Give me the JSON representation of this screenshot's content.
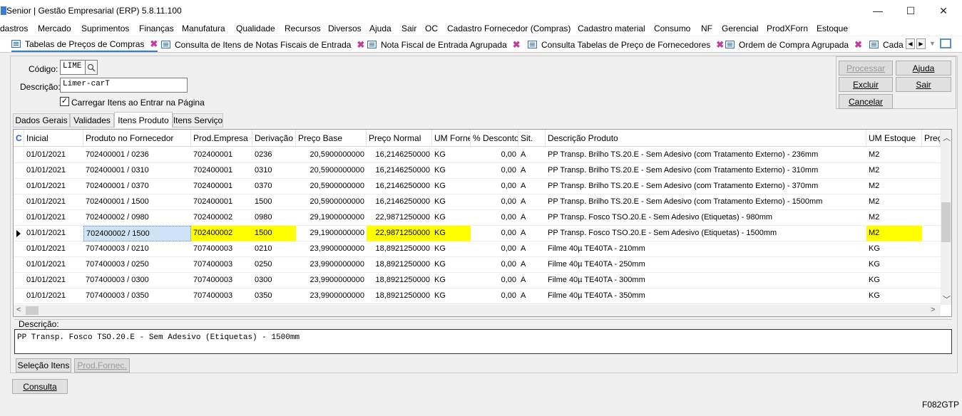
{
  "window": {
    "title": "Senior | Gestão Empresarial (ERP) 5.8.11.100",
    "minimize": "—",
    "maximize": "☐",
    "close": "✕"
  },
  "menu": [
    "dastros",
    "Mercado",
    "Suprimentos",
    "Finanças",
    "Manufatura",
    "Qualidade",
    "Recursos",
    "Diversos",
    "Ajuda",
    "Sair",
    "OC",
    "Cadastro Fornecedor (Compras)",
    "Cadastro material",
    "Consumo",
    "NF",
    "Gerencial",
    "ProdXForn",
    "Estoque"
  ],
  "tabs": [
    {
      "label": "Tabelas de Preços de Compras",
      "active": true
    },
    {
      "label": "Consulta de Itens de Notas Fiscais de Entrada"
    },
    {
      "label": "Nota Fiscal de Entrada Agrupada"
    },
    {
      "label": "Consulta Tabelas de Preço de Fornecedores"
    },
    {
      "label": "Ordem de Compra Agrupada"
    },
    {
      "label": "Cada"
    }
  ],
  "form": {
    "codigo_label": "Código:",
    "codigo_value": "LIME",
    "descricao_label": "Descrição:",
    "descricao_value": "Limer-carT",
    "carregar_label": "Carregar Itens ao Entrar na Página",
    "carregar_checked": "✓"
  },
  "buttons": {
    "processar": "Processar",
    "ajuda": "Ajuda",
    "excluir": "Excluir",
    "sair": "Sair",
    "cancelar": "Cancelar"
  },
  "subtabs": [
    "Dados Gerais",
    "Validades",
    "Itens Produto",
    "Itens Serviço"
  ],
  "grid": {
    "headers": [
      "C",
      "Inicial",
      "Produto no Fornecedor",
      "Prod.Empresa",
      "Derivação",
      "Preço Base",
      "Preço Normal",
      "UM Forne",
      "% Desconto",
      "Sit.",
      "Descrição Produto",
      "UM Estoque",
      "Preç"
    ],
    "rows": [
      [
        "01/01/2021",
        "702400001 / 0236",
        "702400001",
        "0236",
        "20,5900000000",
        "16,2146250000",
        "KG",
        "0,00",
        "A",
        "PP Transp. Brilho TS.20.E - Sem Adesivo (com Tratamento Externo) - 236mm",
        "M2"
      ],
      [
        "01/01/2021",
        "702400001 / 0310",
        "702400001",
        "0310",
        "20,5900000000",
        "16,2146250000",
        "KG",
        "0,00",
        "A",
        "PP Transp. Brilho TS.20.E - Sem Adesivo (com Tratamento Externo) - 310mm",
        "M2"
      ],
      [
        "01/01/2021",
        "702400001 / 0370",
        "702400001",
        "0370",
        "20,5900000000",
        "16,2146250000",
        "KG",
        "0,00",
        "A",
        "PP Transp. Brilho TS.20.E - Sem Adesivo (com Tratamento Externo) - 370mm",
        "M2"
      ],
      [
        "01/01/2021",
        "702400001 / 1500",
        "702400001",
        "1500",
        "20,5900000000",
        "16,2146250000",
        "KG",
        "0,00",
        "A",
        "PP Transp. Brilho TS.20.E - Sem Adesivo (com Tratamento Externo) - 1500mm",
        "M2"
      ],
      [
        "01/01/2021",
        "702400002 / 0980",
        "702400002",
        "0980",
        "29,1900000000",
        "22,9871250000",
        "KG",
        "0,00",
        "A",
        "PP Transp. Fosco TSO.20.E - Sem Adesivo (Etiquetas) - 980mm",
        "M2"
      ],
      [
        "01/01/2021",
        "702400002 / 1500",
        "702400002",
        "1500",
        "29,1900000000",
        "22,9871250000",
        "KG",
        "0,00",
        "A",
        "PP Transp. Fosco TSO.20.E - Sem Adesivo (Etiquetas) - 1500mm",
        "M2"
      ],
      [
        "01/01/2021",
        "707400003 / 0210",
        "707400003",
        "0210",
        "23,9900000000",
        "18,8921250000",
        "KG",
        "0,00",
        "A",
        "Filme 40µ TE40TA - 210mm",
        "KG"
      ],
      [
        "01/01/2021",
        "707400003 / 0250",
        "707400003",
        "0250",
        "23,9900000000",
        "18,8921250000",
        "KG",
        "0,00",
        "A",
        "Filme 40µ TE40TA - 250mm",
        "KG"
      ],
      [
        "01/01/2021",
        "707400003 / 0300",
        "707400003",
        "0300",
        "23,9900000000",
        "18,8921250000",
        "KG",
        "0,00",
        "A",
        "Filme 40µ TE40TA - 300mm",
        "KG"
      ],
      [
        "01/01/2021",
        "707400003 / 0350",
        "707400003",
        "0350",
        "23,9900000000",
        "18,8921250000",
        "KG",
        "0,00",
        "A",
        "Filme 40µ TE40TA - 350mm",
        "KG"
      ]
    ]
  },
  "descricao_panel": {
    "label": "Descrição:",
    "text": "PP Transp. Fosco TSO.20.E - Sem Adesivo (Etiquetas) - 1500mm"
  },
  "bottom_buttons": {
    "selecao": "Seleção Itens",
    "prodfornec": "Prod.Fornec.",
    "consulta": "Consulta"
  },
  "status": "F082GTP",
  "colors": {
    "highlight": "#ffff00",
    "accent": "#2e7cd6",
    "close_x": "#c23ba1"
  }
}
